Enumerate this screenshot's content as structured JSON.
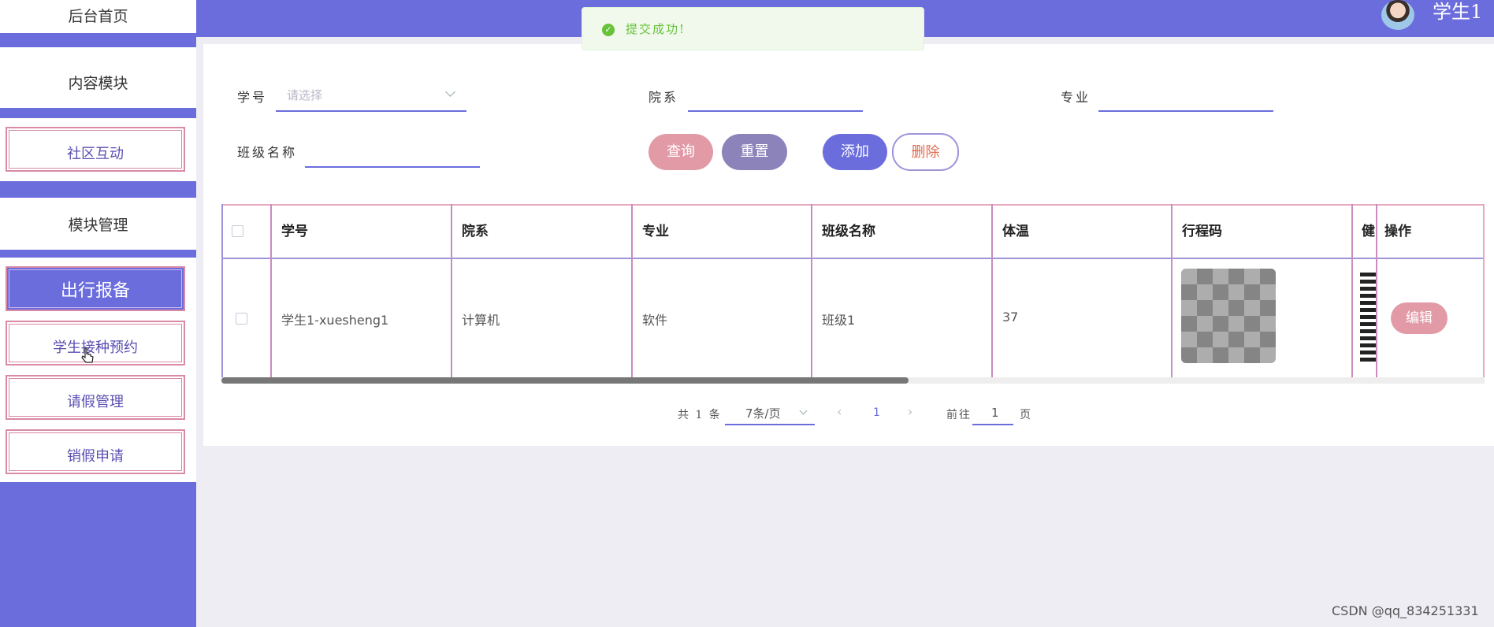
{
  "header": {
    "username": "学生1"
  },
  "toast": {
    "message": "提交成功!"
  },
  "sidebar": {
    "home": "后台首页",
    "content_module": "内容模块",
    "community": "社区互动",
    "module_management": "模块管理",
    "active_item": "出行报备",
    "vaccine": "学生接种预约",
    "leave": "请假管理",
    "cancel_leave": "销假申请"
  },
  "filters": {
    "student_id_label": "学号",
    "student_id_placeholder": "请选择",
    "department_label": "院系",
    "major_label": "专业",
    "class_label": "班级名称"
  },
  "buttons": {
    "query": "查询",
    "reset": "重置",
    "add": "添加",
    "delete": "删除",
    "edit": "编辑"
  },
  "table": {
    "headers": [
      "学号",
      "院系",
      "专业",
      "班级名称",
      "体温",
      "行程码",
      "健",
      "操作"
    ],
    "rows": [
      {
        "student": "学生1-xuesheng1",
        "department": "计算机",
        "major": "软件",
        "class": "班级1",
        "temperature": "37"
      }
    ]
  },
  "pagination": {
    "total": "共 1 条",
    "page_size": "7条/页",
    "current": "1",
    "goto_label": "前往",
    "goto_value": "1",
    "page_suffix": "页"
  },
  "watermark": "CSDN @qq_834251331"
}
